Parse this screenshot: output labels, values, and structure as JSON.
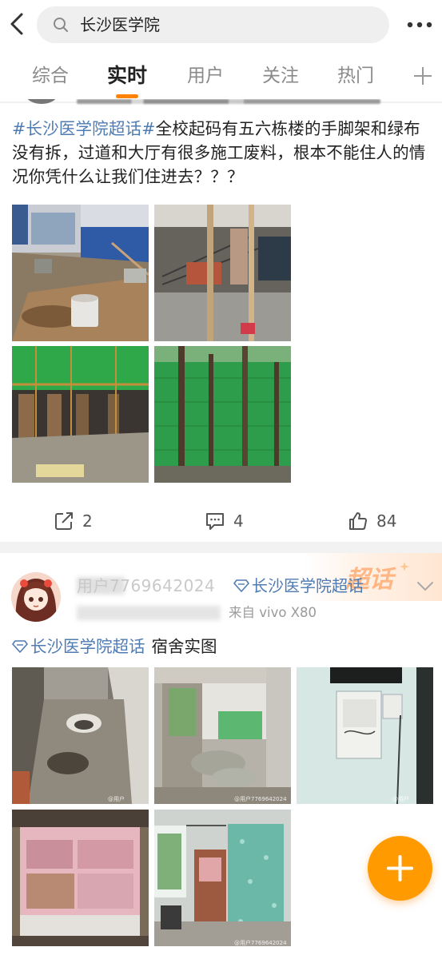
{
  "search": {
    "query": "长沙医学院"
  },
  "tabs": [
    {
      "label": "综合",
      "active": false
    },
    {
      "label": "实时",
      "active": true
    },
    {
      "label": "用户",
      "active": false
    },
    {
      "label": "关注",
      "active": false
    },
    {
      "label": "热门",
      "active": false
    }
  ],
  "icons": {
    "back": "back-arrow-icon",
    "search": "search-icon",
    "more": "more-dots-icon",
    "add_tab": "plus-icon",
    "repost": "repost-icon",
    "comment": "comment-icon",
    "like": "like-icon",
    "compose": "plus-icon"
  },
  "colors": {
    "accent": "#ff8200",
    "topic": "#4f7bb3",
    "fab": "#ff9a00"
  },
  "post1": {
    "topic": "#长沙医学院超话#",
    "text": "全校起码有五六栋楼的手脚架和绿布没有拆，过道和大厅有很多施工废料，根本不能住人的情况你凭什么让我们住进去？？？",
    "images": [
      "corridor-construction-waste",
      "railing-scaffold",
      "building-green-net",
      "building-green-net-trees"
    ],
    "actions": {
      "reposts": "2",
      "comments": "4",
      "likes": "84"
    }
  },
  "post2": {
    "username": "用户7769642024",
    "supertopic": "长沙医学院超话",
    "time_source": "来自 vivo X80",
    "topic": "长沙医学院超话",
    "text": "宿舍实图",
    "banner": "超话",
    "watermark": "@用户7769642024",
    "images": [
      "bathroom-squat-toilet",
      "balcony-rubble-bags",
      "wall-electric-box",
      "pink-desk-shelf",
      "dorm-bunk-beds"
    ]
  }
}
